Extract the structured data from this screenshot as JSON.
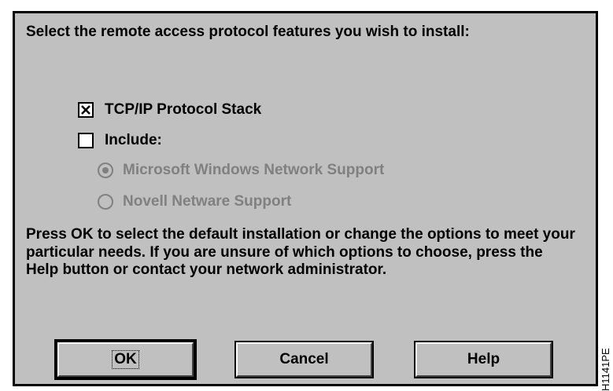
{
  "dialog": {
    "prompt": "Select the remote access protocol features you wish to install:",
    "options": {
      "tcpip": {
        "label": "TCP/IP Protocol Stack",
        "checked": true
      },
      "include": {
        "label": "Include:",
        "checked": false
      }
    },
    "radios": [
      {
        "label": "Microsoft Windows Network Support",
        "selected": true,
        "enabled": false
      },
      {
        "label": "Novell Netware Support",
        "selected": false,
        "enabled": false
      }
    ],
    "info": "Press OK to select the default installation or change the options to meet your particular needs.  If you are unsure of which options to choose,  press the Help button or contact your network administrator.",
    "buttons": {
      "ok": "OK",
      "cancel": "Cancel",
      "help": "Help"
    }
  },
  "side_mark": "H1141PE",
  "colors": {
    "dialog_bg": "#c0c0c0",
    "disabled_text": "#808080",
    "border": "#000000"
  }
}
